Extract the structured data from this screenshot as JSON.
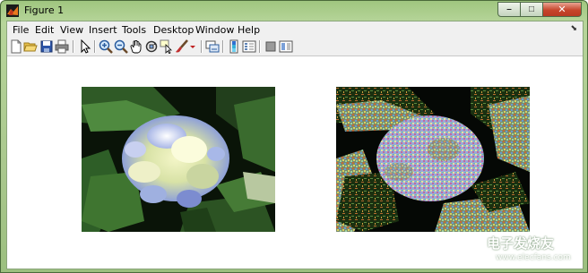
{
  "window": {
    "title": "Figure 1",
    "controls": {
      "minimize": "–",
      "maximize": "□",
      "close": "✕"
    }
  },
  "menubar": {
    "items": [
      "File",
      "Edit",
      "View",
      "Insert",
      "Tools",
      "Desktop",
      "Window",
      "Help"
    ],
    "dock_icon": "dock-arrow-icon"
  },
  "toolbar": {
    "icons": [
      "new-figure-icon",
      "open-file-icon",
      "save-icon",
      "print-icon",
      "edit-plot-arrow-icon",
      "zoom-in-icon",
      "zoom-out-icon",
      "pan-hand-icon",
      "rotate-3d-icon",
      "data-cursor-icon",
      "brush-icon",
      "brush-dropdown-icon",
      "link-plot-icon",
      "insert-colorbar-icon",
      "insert-legend-icon",
      "hide-plot-tools-icon",
      "show-plot-tools-icon"
    ]
  },
  "axes": [
    {
      "name": "axes-original-image",
      "content": "hydrangea photo (original)"
    },
    {
      "name": "axes-processed-image",
      "content": "hydrangea photo (processed, false-color noise)"
    }
  ],
  "watermark": {
    "text": "电子发烧友",
    "url": "www.elecfans.com"
  },
  "colors": {
    "titlebar": "#a9cc8d",
    "client_bg": "#ffffff",
    "menubar_bg": "#f0f0f0",
    "close_button": "#c7462c"
  }
}
